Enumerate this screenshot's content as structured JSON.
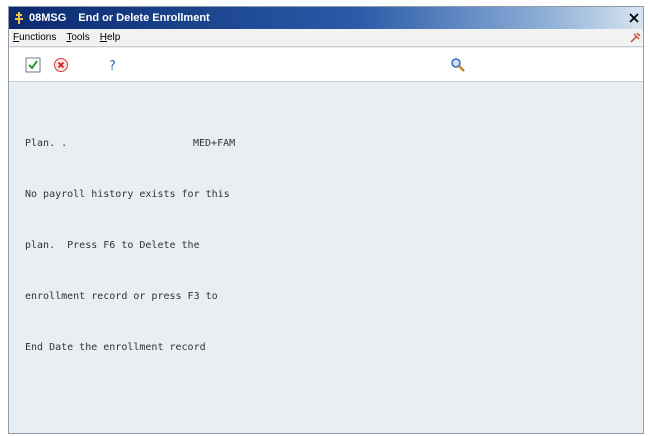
{
  "window": {
    "code": "08MSG",
    "title": "End or Delete Enrollment"
  },
  "menu": {
    "items": [
      {
        "first": "F",
        "rest": "unctions"
      },
      {
        "first": "T",
        "rest": "ools"
      },
      {
        "first": "H",
        "rest": "elp"
      }
    ]
  },
  "toolbar": {
    "icons": [
      "checkmark-icon",
      "cancel-icon",
      "help-icon",
      "search-icon"
    ]
  },
  "message": {
    "plan_label": "Plan. .",
    "plan_value": "MED+FAM",
    "lines": [
      "No payroll history exists for this",
      "plan.  Press F6 to Delete the",
      "enrollment record or press F3 to",
      "End Date the enrollment record"
    ]
  },
  "colors": {
    "titlebar_start": "#0b2a6e",
    "content_bg": "#e9eef2",
    "text": "#333333"
  }
}
